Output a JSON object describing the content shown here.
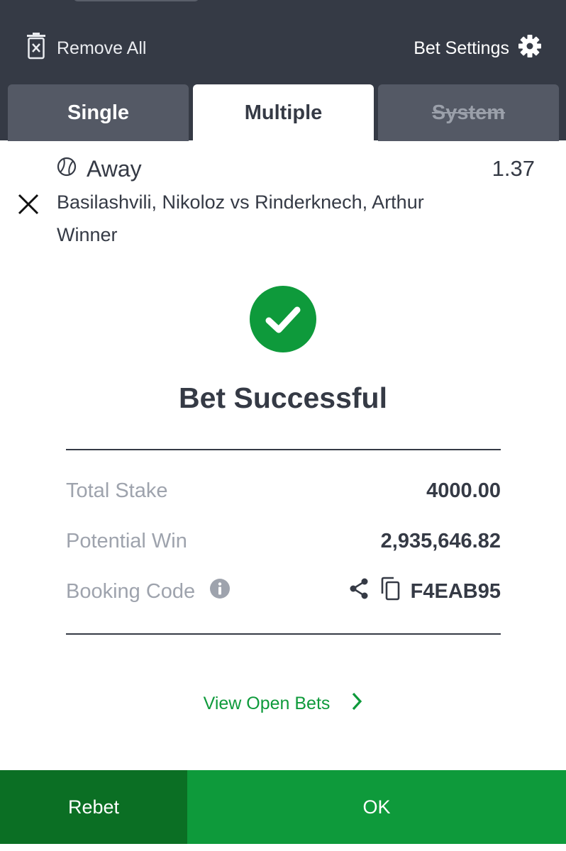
{
  "header": {
    "remove_all": "Remove All",
    "bet_settings": "Bet Settings"
  },
  "tabs": [
    {
      "label": "Single",
      "state": "inactive"
    },
    {
      "label": "Multiple",
      "state": "active"
    },
    {
      "label": "System",
      "state": "disabled"
    }
  ],
  "selection": {
    "pick": "Away",
    "odds": "1.37",
    "match": "Basilashvili, Nikoloz vs Rinderknech, Arthur",
    "market": "Winner"
  },
  "result": {
    "title": "Bet Successful",
    "rows": [
      {
        "label": "Total Stake",
        "value": "4000.00"
      },
      {
        "label": "Potential Win",
        "value": "2,935,646.82"
      },
      {
        "label": "Booking Code",
        "value": "F4EAB95"
      }
    ],
    "view_open_bets": "View Open Bets"
  },
  "footer": {
    "rebet": "Rebet",
    "ok": "OK"
  },
  "colors": {
    "header_bg": "#353a45",
    "tab_inactive": "#545965",
    "green": "#0e9a3b",
    "green_dark": "#0b6f24",
    "label_gray": "#9ea3ad"
  }
}
